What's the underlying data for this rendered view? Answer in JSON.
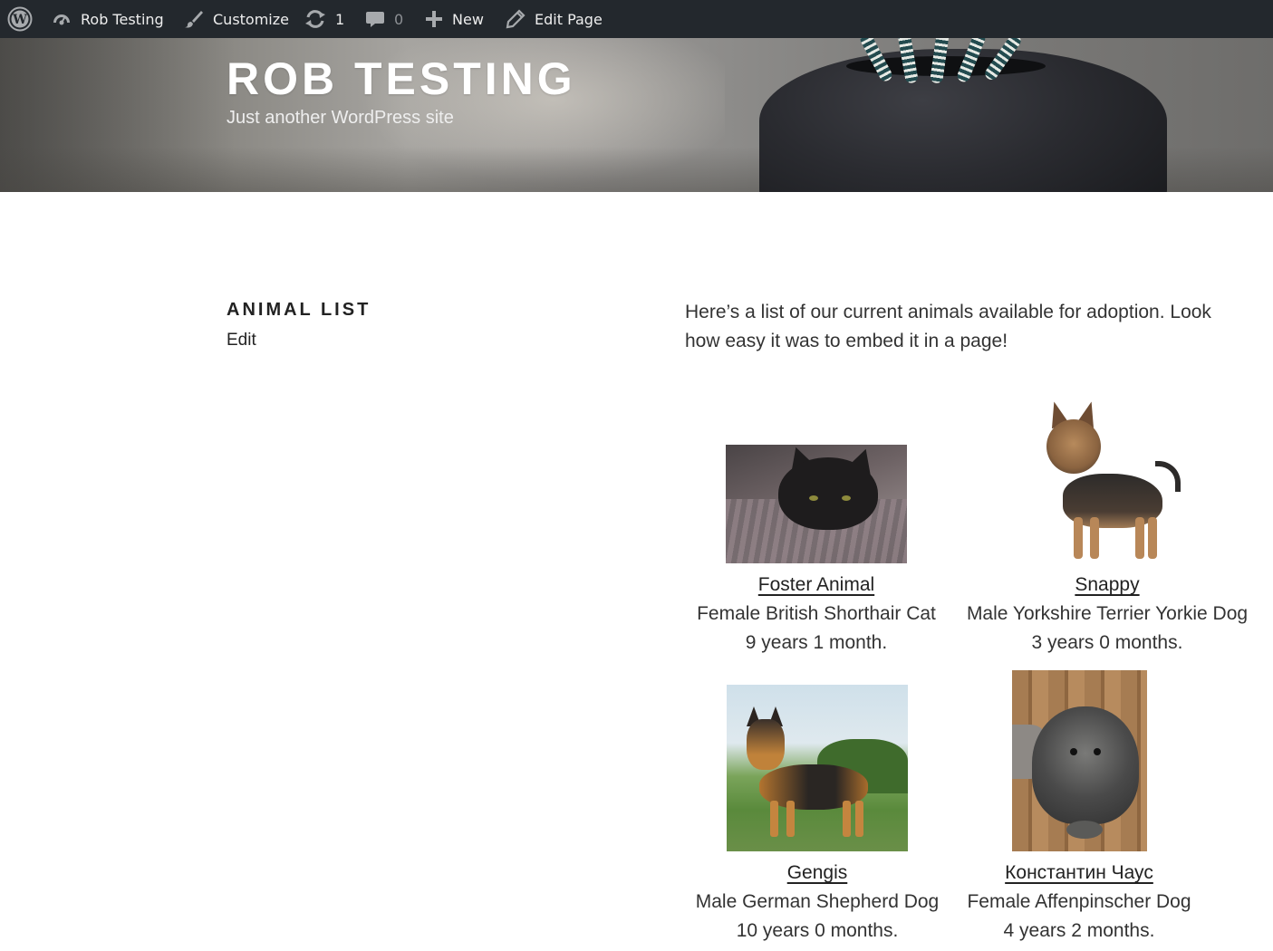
{
  "admin_bar": {
    "site_name": "Rob Testing",
    "customize": "Customize",
    "updates_count": "1",
    "comments_count": "0",
    "new": "New",
    "edit_page": "Edit Page"
  },
  "header": {
    "site_title": "Rob Testing",
    "site_description": "Just another WordPress site"
  },
  "page": {
    "title": "Animal List",
    "edit_link": "Edit",
    "intro": "Here’s a list of our current animals available for adoption. Look how easy it was to embed it in a page!"
  },
  "animals": [
    {
      "name": "Foster Animal",
      "breed": "Female British Shorthair Cat",
      "age": "9 years 1 month.",
      "photo_icon": "cat-photo"
    },
    {
      "name": "Snappy",
      "breed": "Male Yorkshire Terrier Yorkie Dog",
      "age": "3 years 0 months.",
      "photo_icon": "yorkie-photo"
    },
    {
      "name": "Gengis",
      "breed": "Male German Shepherd Dog",
      "age": "10 years 0 months.",
      "photo_icon": "shepherd-photo"
    },
    {
      "name": "Константин Чаус",
      "breed": "Female Affenpinscher Dog",
      "age": "4 years 2 months.",
      "photo_icon": "affenpinscher-photo"
    }
  ],
  "colors": {
    "admin_bar_bg": "#23282d",
    "admin_bar_text": "#eeeeee",
    "heading_text": "#222222",
    "body_text": "#333333"
  }
}
